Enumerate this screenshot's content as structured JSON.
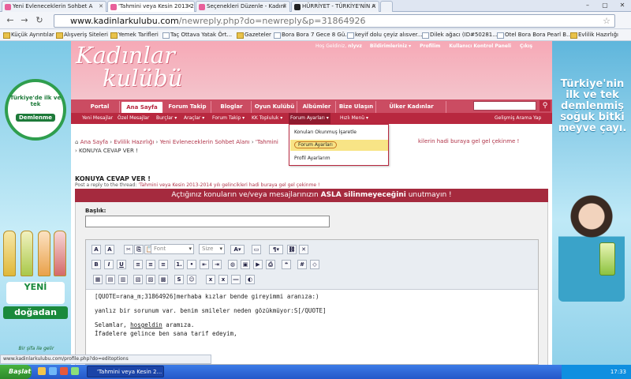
{
  "browser": {
    "tabs": [
      {
        "label": "Yeni Evleneceklerin Sohbet A",
        "active": false
      },
      {
        "label": "'Tahmini veya Kesin 2013-20",
        "active": true
      },
      {
        "label": "Seçenekleri Düzenle - Kadınl",
        "active": false
      },
      {
        "label": "HÜRRİYET - TÜRKİYE'NİN A",
        "active": false
      }
    ],
    "url_host": "www.kadinlarkulubu.com",
    "url_path": "/newreply.php?do=newreply&p=31864926",
    "bookmarks": [
      "Küçük Ayrıntılar",
      "Alışveriş Siteleri",
      "Yemek Tarifleri",
      "Taç Ottava Yatak Ört...",
      "Gazeteler",
      "Bora Bora 7 Gece 8 Gü...",
      "keyif dolu çeyiz alısver...",
      "Dilek ağacı (ID#50281...",
      "Otel Bora Bora Pearl B...",
      "Evlilik Hazırlığı"
    ]
  },
  "left_ad": {
    "seal_text": "Türkiye'de ilk ve tek",
    "seal_brand": "Demlenme",
    "brand_top": "YENİ",
    "brand": "doğadan",
    "slogan": "Bir şifa ile gelir"
  },
  "right_ad": {
    "slogan": "Türkiye'nin ilk ve tek demlenmiş soğuk bitki meyve çayı."
  },
  "site": {
    "logo_line1": "Kadınlar",
    "logo_line2": "kulübü",
    "toplinks": {
      "greeting": "Hoş Geldiniz,",
      "user": "nlyvz",
      "notifications": "Bildirimleriniz ▾",
      "profile": "Profilim",
      "cp": "Kullanıcı Kontrol Paneli",
      "logout": "Çıkış"
    },
    "main_tabs": [
      "Portal",
      "Ana Sayfa",
      "Forum Takip",
      "Bloglar",
      "Oyun Kulübü",
      "Albümler",
      "Bize Ulaşın",
      "Ülker Kadınlar Matinesi"
    ],
    "sub_nav": [
      "Yeni Mesajlar",
      "Özel Mesajlar",
      "Burçlar ▾",
      "Araçlar ▾",
      "Forum Takip ▾",
      "KK Topluluk ▾",
      "Forum Ayarları ▾",
      "Hızlı Menü ▾"
    ],
    "advanced_search": "Gelişmiş Arama Yap",
    "dropdown": [
      "Konuları Okunmuş İşaretle",
      "Forum Ayarları",
      "Profil Ayarlarım"
    ],
    "breadcrumb": [
      "Ana Sayfa",
      "Evlilik Hazırlığı",
      "Yeni Evleneceklerin Sohbet Alanı",
      "'Tahmini",
      "kilerin hadi buraya gel gel çekinme !"
    ],
    "breadcrumb_current": "KONUYA CEVAP VER !",
    "page_title": "KONUYA CEVAP VER !",
    "subtitle_prefix": "Post a reply to the thread:",
    "subtitle_thread": "'Tahmini veya Kesin 2013-2014 yılı gelincikleri hadi buraya gel gel çekinme !",
    "banner_pre": "Açtığınız konuların ve/veya mesajlarınızın",
    "banner_bold": "ASLA silinmeyeceğini",
    "banner_post": "unutmayın !",
    "title_label": "Başlık:",
    "editor": {
      "font_placeholder": "Font",
      "size_placeholder": "Size"
    },
    "content_lines": [
      "[QUOTE=rana_m;31864926]merhaba kızlar bende gireyimmi aranıza:)",
      "yanlız bir sorunum var. benim smileler neden gözükmüyor:S[/QUOTE]",
      "Selamlar, ",
      "hoşgeldin",
      " aramıza.",
      "İfadelere gelince ben sana tarif edeyim,"
    ]
  },
  "status_url": "www.kadinlarkulubu.com/profile.php?do=editoptions",
  "taskbar": {
    "start": "Başlat",
    "item": "'Tahmini veya Kesin 2...",
    "clock": "17:33"
  }
}
